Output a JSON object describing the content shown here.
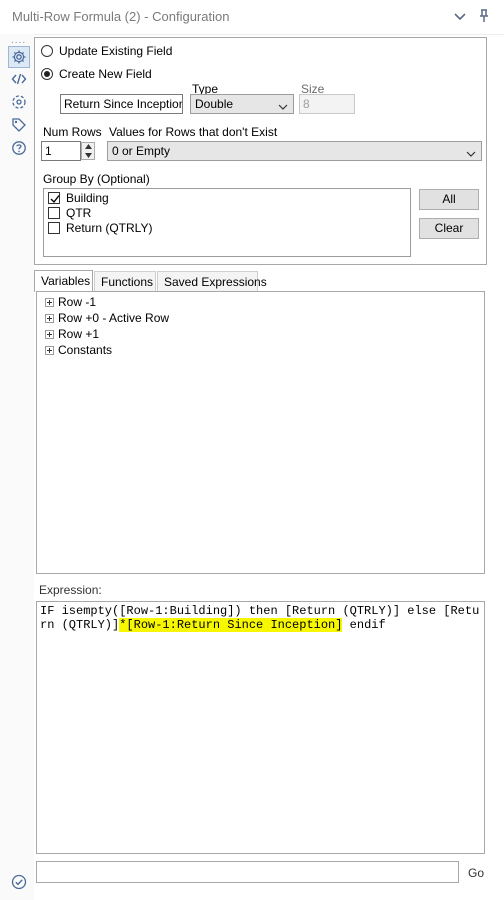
{
  "window": {
    "title": "Multi-Row Formula (2) - Configuration"
  },
  "sidebar": {
    "dots": "....",
    "items": [
      "gear-icon",
      "code-icon",
      "target-icon",
      "tag-icon",
      "help-icon"
    ]
  },
  "config": {
    "update_existing_label": "Update Existing Field",
    "create_new_label": "Create New  Field",
    "type_label": "Type",
    "size_label": "Size",
    "field_name_value": "Return Since Inception",
    "type_value": "Double",
    "size_value": "8",
    "num_rows_label": "Num Rows",
    "num_rows_value": "1",
    "nonexist_label": "Values for Rows that don't Exist",
    "nonexist_value": "0 or Empty",
    "group_by_label": "Group By (Optional)",
    "group_by_items": [
      {
        "label": "Building",
        "checked": true
      },
      {
        "label": "QTR",
        "checked": false
      },
      {
        "label": "Return (QTRLY)",
        "checked": false
      }
    ],
    "all_button": "All",
    "clear_button": "Clear"
  },
  "tabs": [
    {
      "label": "Variables",
      "active": true
    },
    {
      "label": "Functions",
      "active": false
    },
    {
      "label": "Saved Expressions",
      "active": false
    }
  ],
  "tree": {
    "items": [
      "Row -1",
      "Row +0 - Active Row",
      "Row +1",
      "Constants"
    ]
  },
  "expression": {
    "label": "Expression:",
    "text_before": "IF isempty([Row-1:Building]) then [Return (QTRLY)] else [Return (QTRLY)]",
    "text_highlight": "*[Row-1:Return Since Inception]",
    "text_after": " endif",
    "highlight_color": "#f7f700"
  },
  "footer": {
    "go_label": "Go"
  }
}
